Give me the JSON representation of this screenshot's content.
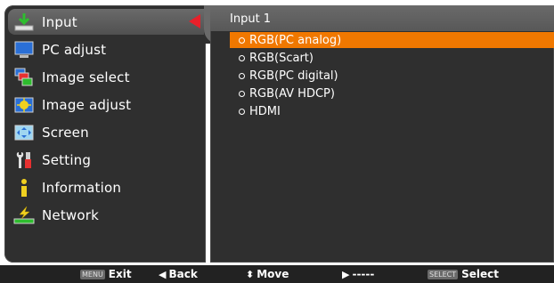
{
  "menu": {
    "items": [
      {
        "label": "Input",
        "icon": "input-icon"
      },
      {
        "label": "PC adjust",
        "icon": "pc-adjust-icon"
      },
      {
        "label": "Image select",
        "icon": "image-select-icon"
      },
      {
        "label": "Image adjust",
        "icon": "image-adjust-icon"
      },
      {
        "label": "Screen",
        "icon": "screen-icon"
      },
      {
        "label": "Setting",
        "icon": "setting-icon"
      },
      {
        "label": "Information",
        "icon": "information-icon"
      },
      {
        "label": "Network",
        "icon": "network-icon"
      }
    ],
    "selected_index": 0
  },
  "submenu": {
    "title": "Input 1",
    "options": [
      {
        "label": "RGB(PC analog)"
      },
      {
        "label": "RGB(Scart)"
      },
      {
        "label": "RGB(PC digital)"
      },
      {
        "label": "RGB(AV HDCP)"
      },
      {
        "label": "HDMI"
      }
    ],
    "selected_index": 0
  },
  "bottom_bar": {
    "exit": {
      "key": "MENU",
      "label": "Exit"
    },
    "back": {
      "glyph": "◀",
      "label": "Back"
    },
    "move": {
      "glyph": "⬍",
      "label": "Move"
    },
    "next": {
      "glyph": "▶",
      "label": "-----"
    },
    "select": {
      "key": "SELECT",
      "label": "Select"
    }
  },
  "colors": {
    "panel_bg": "#2f2f2f",
    "highlight_bg": "#f07800",
    "arrow_red": "#e8202a",
    "bar_bg": "#222222"
  }
}
